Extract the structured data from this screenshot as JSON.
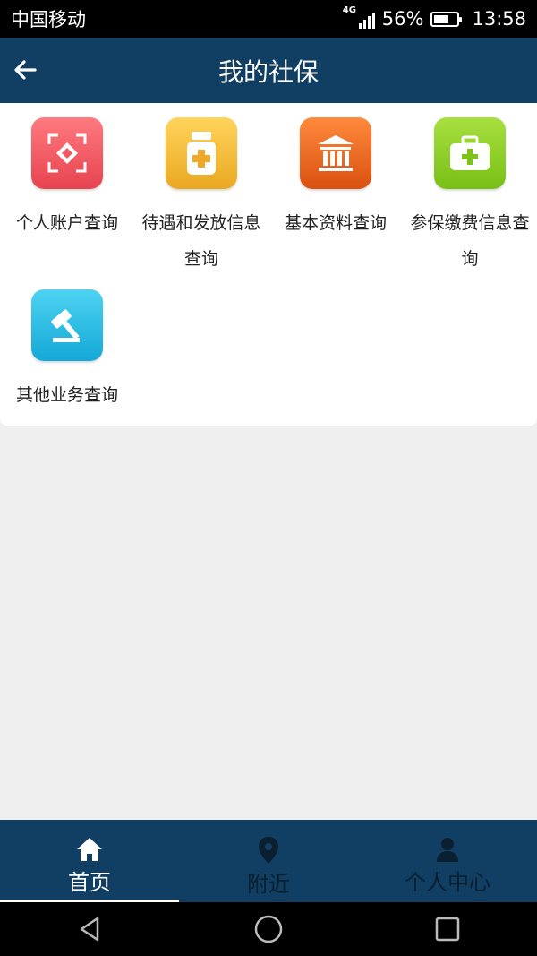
{
  "status_bar": {
    "carrier": "中国移动",
    "network": "4G",
    "battery": "56%",
    "battery_level": 0.56,
    "time": "13:58"
  },
  "header": {
    "title": "我的社保",
    "back_icon": "arrow-left-icon"
  },
  "services": [
    {
      "label": "个人账户查询",
      "icon": "account-icon",
      "color": "#f0555f"
    },
    {
      "label": "待遇和发放信息查询",
      "icon": "medicine-bottle-icon",
      "color": "#f2b632"
    },
    {
      "label": "基本资料查询",
      "icon": "bank-icon",
      "color": "#e85e1e"
    },
    {
      "label": "参保缴费信息查询",
      "icon": "medical-kit-icon",
      "color": "#8fd12b"
    },
    {
      "label": "其他业务查询",
      "icon": "gavel-icon",
      "color": "#21b8e0"
    }
  ],
  "bottom_nav": [
    {
      "label": "首页",
      "icon": "home-icon",
      "active": true
    },
    {
      "label": "附近",
      "icon": "location-pin-icon",
      "active": false
    },
    {
      "label": "个人中心",
      "icon": "person-icon",
      "active": false
    }
  ],
  "colors": {
    "header_bg": "#113f63",
    "page_bg": "#efefef"
  }
}
